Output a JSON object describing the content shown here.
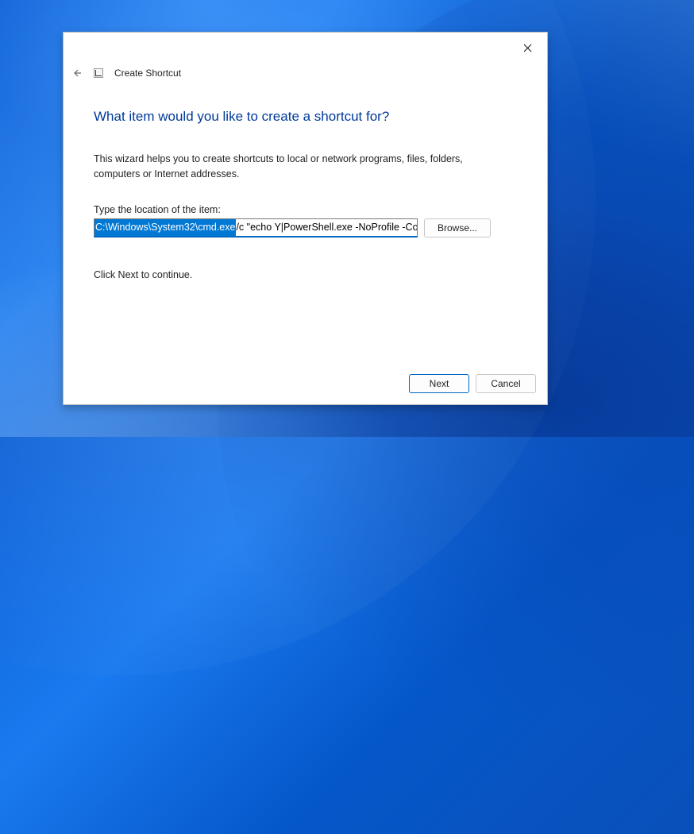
{
  "window": {
    "title": "Create Shortcut"
  },
  "wizard": {
    "headline": "What item would you like to create a shortcut for?",
    "description": "This wizard helps you to create shortcuts to local or network programs, files, folders, computers or Internet addresses.",
    "field_label": "Type the location of the item:",
    "location_value_selected": "C:\\Windows\\System32\\cmd.exe",
    "location_value_rest": " /c \"echo Y|PowerShell.exe -NoProfile -Com",
    "browse_label": "Browse...",
    "continue_hint": "Click Next to continue."
  },
  "buttons": {
    "next": "Next",
    "cancel": "Cancel"
  }
}
